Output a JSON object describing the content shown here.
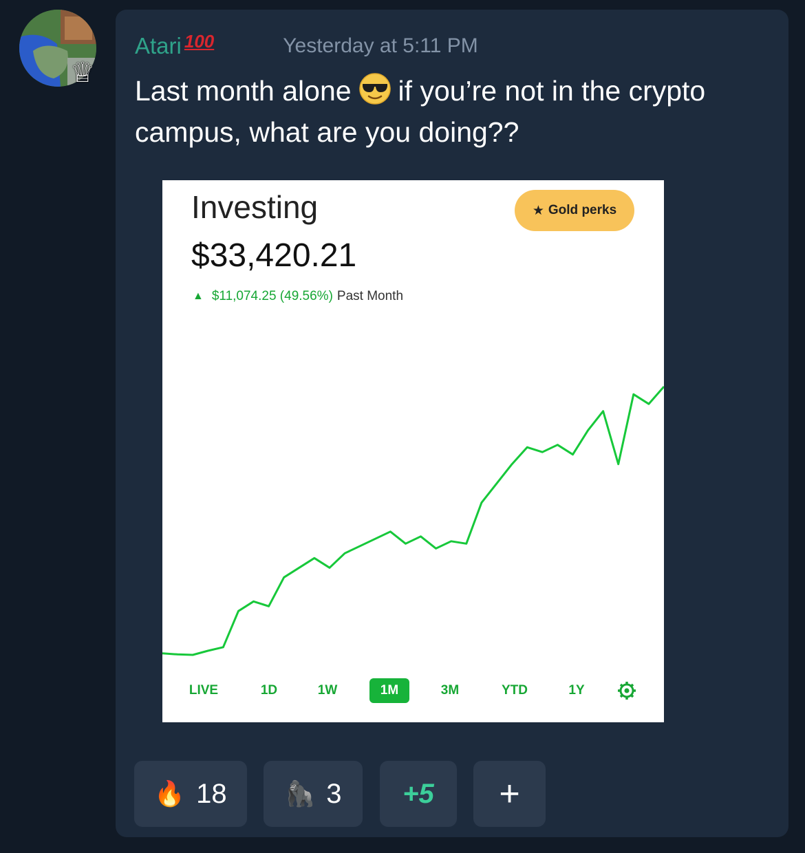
{
  "message": {
    "username": "Atari",
    "username_badge": "100",
    "timestamp": "Yesterday at 5:11 PM",
    "text_before_emoji": "Last month alone",
    "text_after_emoji": "if you’re not in the crypto campus, what are you doing??",
    "emoji_inline": "sunglasses-face-icon"
  },
  "avatar": {
    "badge_icon": "crown-icon"
  },
  "screenshot": {
    "title": "Investing",
    "value": "$33,420.21",
    "gold_perks_label": "Gold perks",
    "gain_value": "$11,074.25 (49.56%)",
    "gain_label": "Past Month",
    "ranges": [
      "LIVE",
      "1D",
      "1W",
      "1M",
      "3M",
      "YTD",
      "1Y"
    ],
    "active_range": "1M",
    "settings_icon": "gear-icon",
    "line_color": "#17c83a"
  },
  "chart_data": {
    "type": "line",
    "title": "",
    "xlabel": "",
    "ylabel": "",
    "values": [
      22346,
      22300,
      22280,
      22450,
      22600,
      24100,
      24500,
      24300,
      25500,
      25900,
      26300,
      25900,
      26500,
      26800,
      27100,
      27400,
      26900,
      27200,
      26700,
      27000,
      26900,
      28600,
      29400,
      30200,
      30900,
      30700,
      31000,
      30600,
      31600,
      32400,
      30200,
      33100,
      32700,
      33420
    ]
  },
  "reactions": [
    {
      "emoji": "🔥",
      "icon": "fire-icon",
      "count": "18"
    },
    {
      "emoji": "🦍",
      "icon": "gorilla-icon",
      "count": "3"
    },
    {
      "label": "+5"
    },
    {
      "label": "+"
    }
  ]
}
